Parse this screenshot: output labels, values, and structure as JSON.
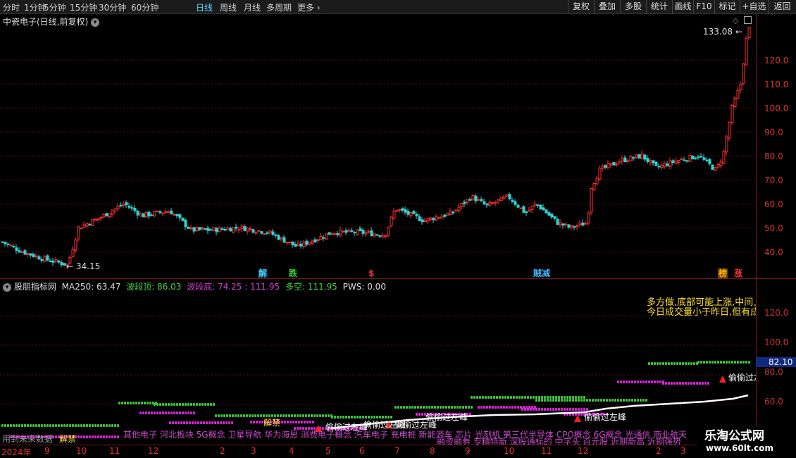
{
  "timeframes": [
    "分时",
    "1分钟",
    "5分钟",
    "15分钟",
    "30分钟",
    "60分钟",
    "日线",
    "周线",
    "月线",
    "多周期",
    "更多"
  ],
  "active_timeframe": "日线",
  "toolbar_right": [
    "复权",
    "叠加",
    "多股",
    "统计",
    "画线",
    "F10",
    "标记",
    "+自选",
    "返回"
  ],
  "main_title": "中瓷电子(日线,前复权)",
  "price_axis": [
    "120.0",
    "110.0",
    "100.0",
    "90.0",
    "80.0",
    "70.0",
    "60.0",
    "50.0",
    "40.0"
  ],
  "price_high_label": "133.08",
  "price_low_label": "34.15",
  "signals": [
    {
      "text": "解",
      "color": "#3fd0ff"
    },
    {
      "text": "跌",
      "color": "#34d634"
    },
    {
      "text": "$",
      "color": "#ff3030"
    },
    {
      "text": "贼减",
      "color": "#3fb8ff"
    },
    {
      "text": "榜",
      "color": "#ffb000"
    },
    {
      "text": "涨",
      "color": "#ff3030"
    }
  ],
  "indicator": {
    "name": "股朋指标网",
    "ma250_label": "MA250: 63.47",
    "top_label": "波段顶: 86.03",
    "bottom_label": "波段底: 74.25",
    "bottom_value": ": 111.95",
    "multi_label": "多空: 111.95",
    "pws_label": "PWS: 0.00",
    "axis": [
      "120.0",
      "100.0",
      "80.0",
      "60.0"
    ],
    "current_value": "82.10",
    "tip_line1": "多方做,底部可能上涨,中间上涨",
    "tip_line2": "今日成交量小于昨日,但有成"
  },
  "annotations": [
    "解禁",
    "偷偷过左峰",
    "偷偷过左峰",
    "偷偷过左峰",
    "偷偷过左峰",
    "偷偷过左峰",
    "偷偷过左",
    "解禁"
  ],
  "future_text": "用到未来数据",
  "concept_line1": "其他电子 河北板块 5G概念 卫星导航 华为海思 消费电子概念 汽车电子 充电桩 新能源车 芯片 光刻机 第三代半导体 CPO概念 6G概念 光通信 商业航天",
  "concept_line2": "融资融券 专精特新 深股通标的 中字头 百元股 近期新高 近期强势",
  "xaxis_labels": [
    "2024年",
    "9",
    "10",
    "11",
    "12",
    "2",
    "3",
    "4",
    "5",
    "6",
    "7",
    "8",
    "9",
    "10",
    "11",
    "12",
    "2",
    "3"
  ],
  "watermark_cn": "乐淘公式网",
  "watermark_url": "www.60lt.com",
  "colors": {
    "up": "#ff3030",
    "down": "#30d0d0",
    "axis": "#e03434",
    "grid": "#5a1010"
  }
}
